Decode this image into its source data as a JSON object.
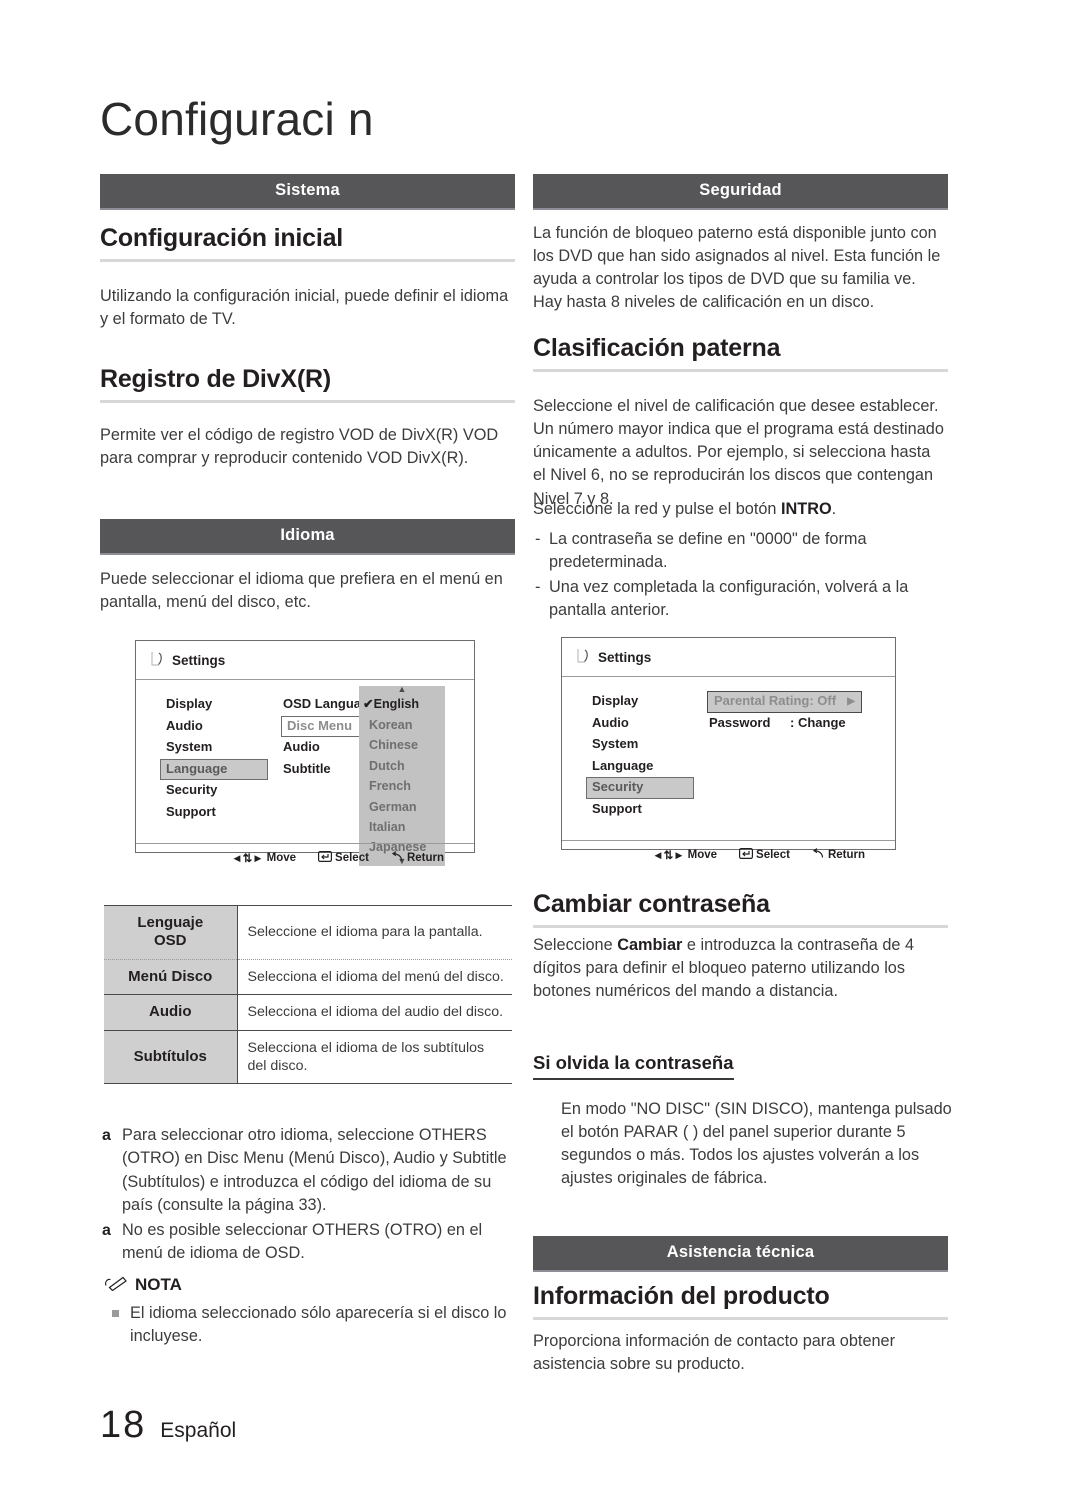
{
  "title": "Configuraci n",
  "footer": {
    "page_number": "18",
    "language": "Español"
  },
  "left_column": {
    "section_bar_system": "Sistema",
    "heading_initial_setup": "Configuración inicial",
    "para_initial_setup": "Utilizando la configuración inicial, puede definir el idioma y el formato de TV.",
    "heading_divx": "Registro de DivX(R)",
    "para_divx": "Permite ver el código de registro VOD de DivX(R) VOD para comprar y reproducir contenido VOD DivX(R).",
    "section_bar_language": "Idioma",
    "para_language": "Puede seleccionar el idioma que prefiera en el menú en pantalla, menú del disco, etc.",
    "osd_language": {
      "title": "Settings",
      "title_icon": "gear-icon",
      "left_menu": [
        {
          "label": "Display",
          "selected": false
        },
        {
          "label": "Audio",
          "selected": false
        },
        {
          "label": "System",
          "selected": false
        },
        {
          "label": "Language",
          "selected": true
        },
        {
          "label": "Security",
          "selected": false
        },
        {
          "label": "Support",
          "selected": false
        }
      ],
      "mid_menu": [
        {
          "label": "OSD Language",
          "boxed": false
        },
        {
          "label": "Disc Menu",
          "boxed": true
        },
        {
          "label": "Audio",
          "boxed": false
        },
        {
          "label": "Subtitle",
          "boxed": false
        }
      ],
      "dropdown": [
        {
          "label": "English",
          "checked": true
        },
        {
          "label": "Korean",
          "checked": false
        },
        {
          "label": "Chinese",
          "checked": false
        },
        {
          "label": "Dutch",
          "checked": false
        },
        {
          "label": "French",
          "checked": false
        },
        {
          "label": "German",
          "checked": false
        },
        {
          "label": "Italian",
          "checked": false
        },
        {
          "label": "Japanese",
          "checked": false
        }
      ],
      "footer": {
        "move": "Move",
        "select": "Select",
        "return": "Return"
      }
    },
    "table": {
      "rows": [
        {
          "term": "Lenguaje\nOSD",
          "desc": "Seleccione el idioma para la pantalla."
        },
        {
          "term": "Menú Disco",
          "desc": "Selecciona el idioma del menú del disco."
        },
        {
          "term": "Audio",
          "desc": "Selecciona el idioma del audio del disco."
        },
        {
          "term": "Subtítulos",
          "desc": "Selecciona el idioma de los subtítulos del disco."
        }
      ]
    },
    "a_notes": [
      "Para seleccionar otro idioma, seleccione OTHERS (OTRO) en Disc Menu (Menú Disco), Audio y Subtitle (Subtítulos) e introduzca el código del idioma de su país (consulte la página 33).",
      "No es posible seleccionar OTHERS (OTRO) en el menú de idioma de OSD."
    ],
    "nota_label": "NOTA",
    "nota_items": [
      "El idioma seleccionado sólo aparecería si el disco lo incluyese."
    ]
  },
  "right_column": {
    "section_bar_security": "Seguridad",
    "para_security": "La función de bloqueo paterno está disponible junto con los DVD que han sido asignados al nivel. Esta función le ayuda a controlar los tipos de DVD que su familia ve. Hay hasta 8 niveles de calificación en un disco.",
    "heading_parental": "Clasificación paterna",
    "para_parental_1": "Seleccione el nivel de calificación que desee establecer. Un número mayor indica que el programa está destinado únicamente a adultos. Por ejemplo, si selecciona hasta el Nivel 6, no se reproducirán los discos que contengan Nivel 7 y 8.",
    "para_parental_2_pre": "Seleccione la red y pulse el botón ",
    "para_parental_2_bold": "INTRO",
    "para_parental_2_post": ".",
    "dash_notes": [
      "La contraseña se define en \"0000\" de forma predeterminada.",
      "Una vez completada la configuración, volverá a la pantalla anterior."
    ],
    "osd_security": {
      "title": "Settings",
      "title_icon": "gear-icon",
      "left_menu": [
        {
          "label": "Display",
          "selected": false
        },
        {
          "label": "Audio",
          "selected": false
        },
        {
          "label": "System",
          "selected": false
        },
        {
          "label": "Language",
          "selected": false
        },
        {
          "label": "Security",
          "selected": true
        },
        {
          "label": "Support",
          "selected": false
        }
      ],
      "settings_rows": [
        {
          "label": "Parental Rating",
          "value": ": Off",
          "highlighted": true,
          "arrow": "right-arrow-icon"
        },
        {
          "label": "Password",
          "value": ": Change",
          "highlighted": false
        }
      ],
      "footer": {
        "move": "Move",
        "select": "Select",
        "return": "Return"
      }
    },
    "heading_change_password": "Cambiar contraseña",
    "para_change_password_pre": "Seleccione ",
    "para_change_password_bold": "Cambiar",
    "para_change_password_post": " e introduzca la contraseña de 4 dígitos para definir el bloqueo paterno utilizando los botones numéricos del mando a distancia.",
    "subheading_forgot": "Si olvida la contraseña",
    "para_forgot": "En modo \"NO DISC\" (SIN DISCO), mantenga pulsado el botón PARAR (  ) del panel superior durante 5 segundos o más. Todos los ajustes volverán a los ajustes originales de fábrica.",
    "section_bar_support": "Asistencia técnica",
    "heading_product_info": "Información del producto",
    "para_product_info": "Proporciona información de contacto para obtener asistencia sobre su producto."
  }
}
